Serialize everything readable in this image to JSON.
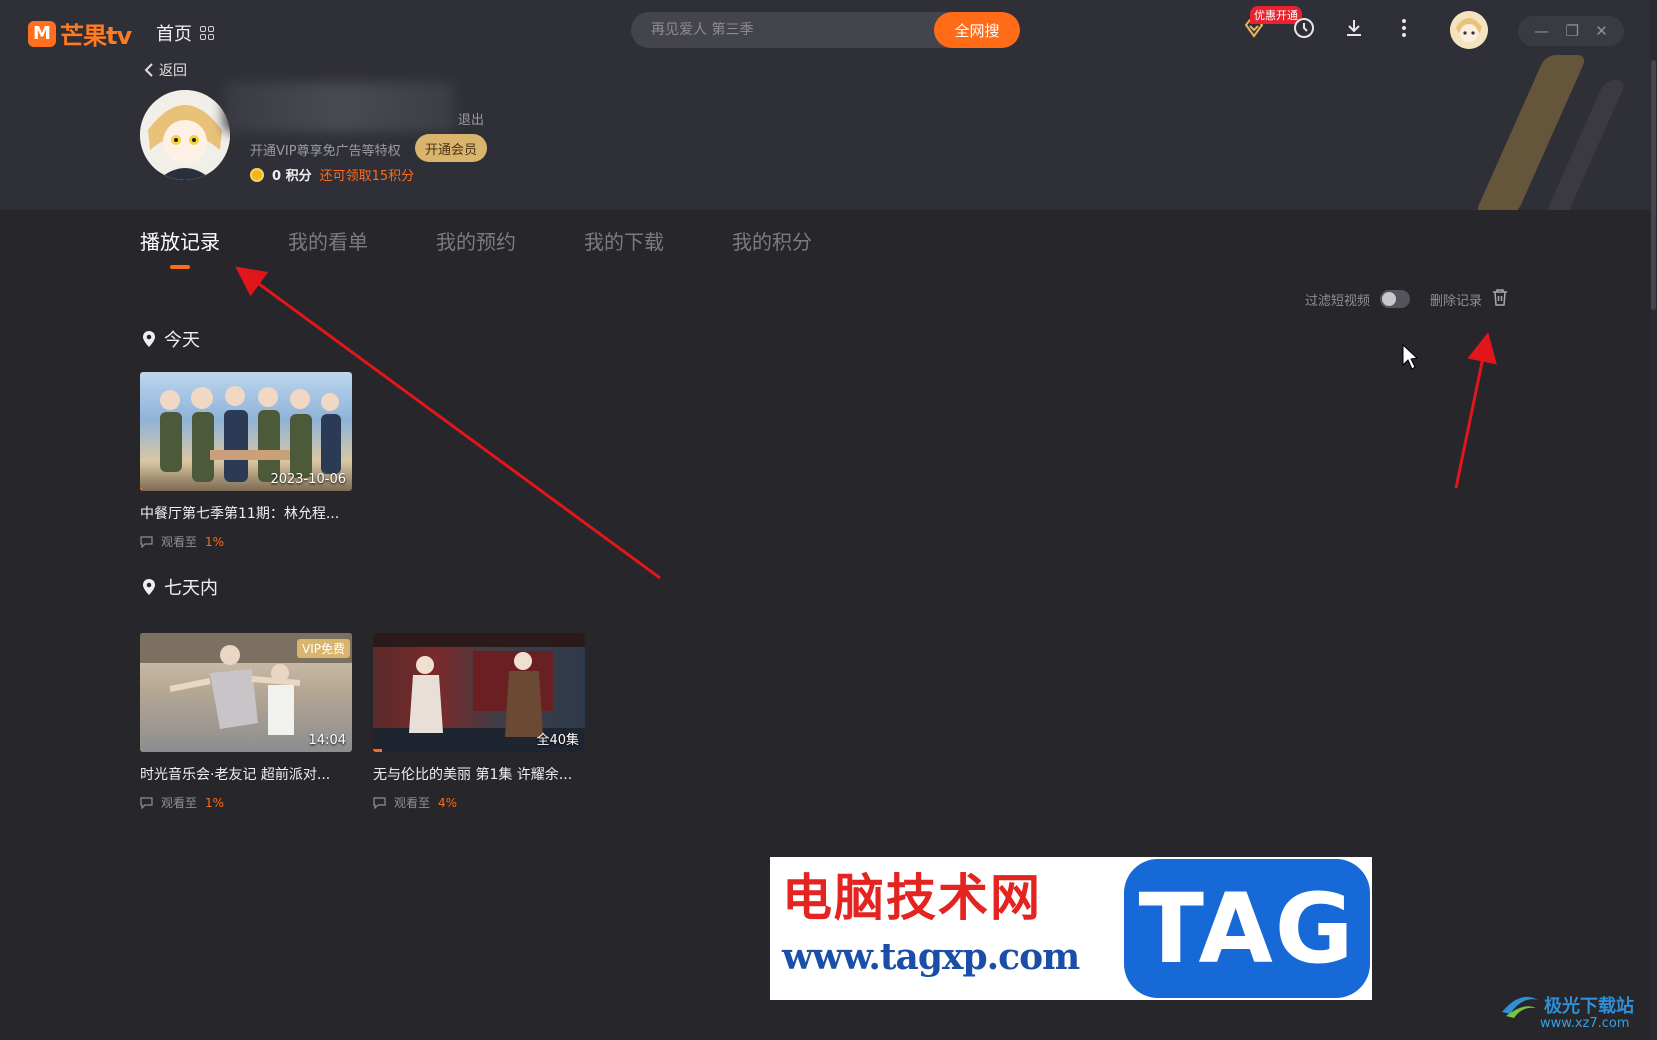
{
  "app": {
    "logo_text": "芒果tv",
    "logo_mark": "M",
    "nav_home": "首页"
  },
  "search": {
    "placeholder": "再见爱人 第三季",
    "button": "全网搜"
  },
  "top_icons": {
    "promo_badge": "优惠开通",
    "icons": [
      "vip-diamond-icon",
      "history-clock-icon",
      "download-icon",
      "more-vertical-icon"
    ]
  },
  "window_controls": {
    "minimize": "—",
    "restore": "❐",
    "close": "✕"
  },
  "profile": {
    "back_label": "返回",
    "logout": "退出",
    "vip_tip": "开通VIP尊享免广告等特权",
    "vip_button": "开通会员",
    "points": "0 积分",
    "points_claim": "还可领取15积分"
  },
  "tabs": [
    {
      "label": "播放记录",
      "active": true
    },
    {
      "label": "我的看单",
      "active": false
    },
    {
      "label": "我的预约",
      "active": false
    },
    {
      "label": "我的下载",
      "active": false
    },
    {
      "label": "我的积分",
      "active": false
    }
  ],
  "filter": {
    "short_video_label": "过滤短视频",
    "short_video_on": false,
    "delete_label": "删除记录"
  },
  "sections": [
    {
      "heading": "今天",
      "items": [
        {
          "badge": "2023-10-06",
          "vip": "",
          "title": "中餐厅第七季第11期：林允程...",
          "watched_label": "观看至",
          "progress": "1%",
          "progress_value": 0.01,
          "colors": [
            "#8fb3d8",
            "#d9c7a3"
          ]
        }
      ]
    },
    {
      "heading": "七天内",
      "items": [
        {
          "badge": "14:04",
          "vip": "VIP免费",
          "title": "时光音乐会·老友记 超前派对...",
          "watched_label": "观看至",
          "progress": "1%",
          "progress_value": 0.01,
          "colors": [
            "#c9b9a6",
            "#6f7f8f"
          ]
        },
        {
          "badge": "全40集",
          "vip": "",
          "title": "无与伦比的美丽 第1集 许耀余...",
          "watched_label": "观看至",
          "progress": "4%",
          "progress_value": 0.04,
          "colors": [
            "#7a2a2a",
            "#2e3a4a"
          ]
        }
      ]
    }
  ],
  "watermark": {
    "cn": "电脑技术网",
    "url": "www.tagxp.com",
    "tag": "TAG"
  },
  "corner_logo": {
    "cn": "极光下载站",
    "url": "www.xz7.com"
  },
  "accent_color": "#ff6b17"
}
